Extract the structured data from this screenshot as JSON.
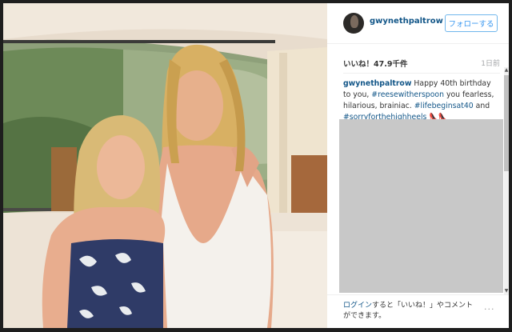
{
  "post": {
    "photo_alt": "",
    "username": "gwynethpaltrow",
    "follow_label": "フォローする",
    "likes": "いいね！47.9千件",
    "time_ago": "1日前",
    "caption": {
      "username": "gwynethpaltrow",
      "text_1": " Happy 40th birthday to you, ",
      "tag_1": "#reesewitherspoon",
      "text_2": " you fearless, hilarious, brainiac. ",
      "tag_2": "#lifebeginsat40",
      "text_3": " and ",
      "tag_3": "#sorryforthehighheels",
      "emoji": "👠👠"
    },
    "footer": {
      "login_link": "ログイン",
      "login_rest": "すると「いいね！」やコメントができます。",
      "more": "···"
    }
  },
  "colors": {
    "link": "#125688",
    "follow_border": "#70b7ec",
    "follow_text": "#3897f0",
    "placeholder": "#c8c8c8"
  }
}
